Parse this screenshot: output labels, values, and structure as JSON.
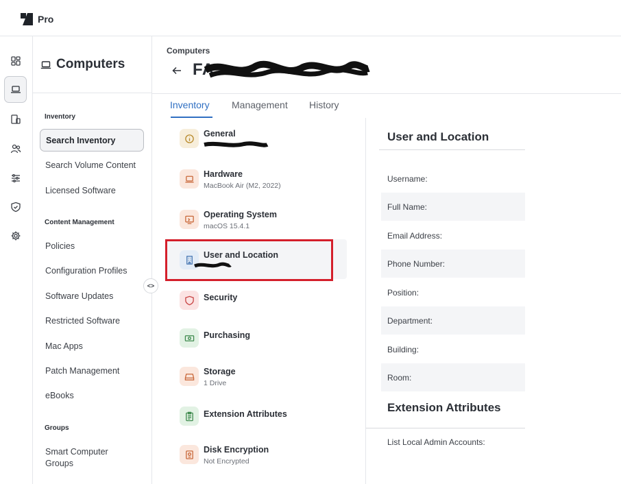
{
  "app": {
    "brand": "Pro"
  },
  "sidebar": {
    "title": "Computers",
    "sections": [
      {
        "label": "Inventory"
      },
      {
        "label": "Content Management"
      },
      {
        "label": "Groups"
      }
    ],
    "items": [
      {
        "label": "Search Inventory",
        "active": true
      },
      {
        "label": "Search Volume Content"
      },
      {
        "label": "Licensed Software"
      },
      {
        "label": "Policies"
      },
      {
        "label": "Configuration Profiles"
      },
      {
        "label": "Software Updates"
      },
      {
        "label": "Restricted Software"
      },
      {
        "label": "Mac Apps"
      },
      {
        "label": "Patch Management"
      },
      {
        "label": "eBooks"
      },
      {
        "label": "Smart Computer Groups"
      }
    ],
    "collapse_icon": "<>"
  },
  "header": {
    "breadcrumb": "Computers",
    "device_name": "FA"
  },
  "tabs": [
    {
      "label": "Inventory",
      "active": true
    },
    {
      "label": "Management"
    },
    {
      "label": "History"
    }
  ],
  "categories": [
    {
      "name": "General",
      "sub": "",
      "icon": "info-icon",
      "color": "#f7eedb"
    },
    {
      "name": "Hardware",
      "sub": "MacBook Air (M2, 2022)",
      "icon": "laptop-icon",
      "color": "#fbe7dd"
    },
    {
      "name": "Operating System",
      "sub": "macOS 15.4.1",
      "icon": "os-icon",
      "color": "#fbe7dd"
    },
    {
      "name": "User and Location",
      "sub": "",
      "icon": "building-icon",
      "color": "#e3ecf7"
    },
    {
      "name": "Security",
      "sub": "",
      "icon": "shield-icon",
      "color": "#fbe3e3"
    },
    {
      "name": "Purchasing",
      "sub": "",
      "icon": "money-icon",
      "color": "#e2f2e4"
    },
    {
      "name": "Storage",
      "sub": "1 Drive",
      "icon": "drive-icon",
      "color": "#fbe7dd"
    },
    {
      "name": "Extension Attributes",
      "sub": "",
      "icon": "clipboard-icon",
      "color": "#e2f2e4"
    },
    {
      "name": "Disk Encryption",
      "sub": "Not Encrypted",
      "icon": "lock-icon",
      "color": "#fbe7dd"
    }
  ],
  "panel": {
    "title": "User and Location",
    "fields": [
      {
        "label": "Username:"
      },
      {
        "label": "Full Name:"
      },
      {
        "label": "Email Address:"
      },
      {
        "label": "Phone Number:"
      },
      {
        "label": "Position:"
      },
      {
        "label": "Department:"
      },
      {
        "label": "Building:"
      },
      {
        "label": "Room:"
      }
    ],
    "ext_title": "Extension Attributes",
    "ext_fields": [
      {
        "label": "List Local Admin Accounts:"
      }
    ]
  },
  "colors": {
    "accent": "#2f6fc2",
    "highlight_box": "#d41f2b"
  }
}
